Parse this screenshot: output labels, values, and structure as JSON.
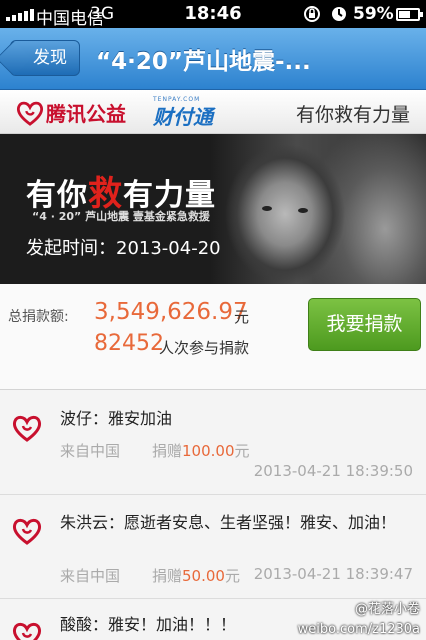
{
  "status_bar": {
    "carrier": "中国电信",
    "network": "3G",
    "time": "18:46",
    "battery_percent": "59%",
    "battery_level": 0.59
  },
  "nav": {
    "back_label": "发现",
    "title": "“4·20”芦山地震-..."
  },
  "brand": {
    "logo_text": "腾讯公益",
    "partner_small": "TENPAY.COM",
    "partner_name": "财付通",
    "slogan": "有你救有力量"
  },
  "banner": {
    "headline_part1": "有你",
    "headline_em": "救",
    "headline_part2": "有力量",
    "subline": "“4 · 20” 芦山地震   壹基金紧急救援",
    "date_label": "发起时间：",
    "date_value": "2013-04-20"
  },
  "summary": {
    "total_label": "总捐款额:",
    "total_amount": "3,549,626.97",
    "total_unit": "元",
    "participants": "82452",
    "participants_unit": "人次参与捐款",
    "donate_button": "我要捐款"
  },
  "feed": [
    {
      "name": "波仔",
      "message": "波仔：雅安加油",
      "from": "来自中国",
      "donation_prefix": "捐赠",
      "amount": "100.00",
      "unit": "元",
      "time": "2013-04-21 18:39:50"
    },
    {
      "name": "朱洪云",
      "message": "朱洪云：愿逝者安息、生者坚强！雅安、加油！",
      "from": "来自中国",
      "donation_prefix": "捐赠",
      "amount": "50.00",
      "unit": "元",
      "time": "2013-04-21 18:39:47"
    },
    {
      "name": "酸酸",
      "message": "酸酸：雅安！加油！！！"
    }
  ],
  "watermark": {
    "line1": "@花落小卷",
    "line2": "weibo.com/z1230a"
  },
  "colors": {
    "nav_blue": "#2d82cf",
    "brand_red": "#c8102e",
    "amount_orange": "#e8693a",
    "donate_green": "#5aa82a"
  }
}
